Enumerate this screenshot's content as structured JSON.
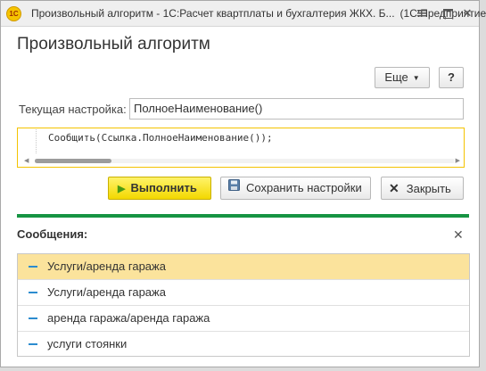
{
  "window": {
    "title": "Произвольный алгоритм - 1С:Расчет квартплаты и бухгалтерия ЖКХ. Б...",
    "app": "(1С:Предприятие)",
    "logo": "1С"
  },
  "form": {
    "title": "Произвольный алгоритм",
    "more_button": "Еще",
    "help_button": "?"
  },
  "setting": {
    "label": "Текущая настройка:",
    "value": "ПолноеНаименование()"
  },
  "code": {
    "line": "Сообщить(Ссылка.ПолноеНаименование());",
    "scroll_position": 0.0
  },
  "actions": {
    "run": "Выполнить",
    "save": "Сохранить настройки",
    "close": "Закрыть"
  },
  "messages": {
    "title": "Сообщения:",
    "items": [
      "Услуги/аренда гаража",
      "Услуги/аренда гаража",
      "аренда гаража/аренда гаража",
      "услуги стоянки"
    ]
  },
  "colors": {
    "accent_green": "#169443",
    "run_button": "#f3d800",
    "selected_row": "#fbe39c",
    "message_marker": "#2c8ccf"
  }
}
